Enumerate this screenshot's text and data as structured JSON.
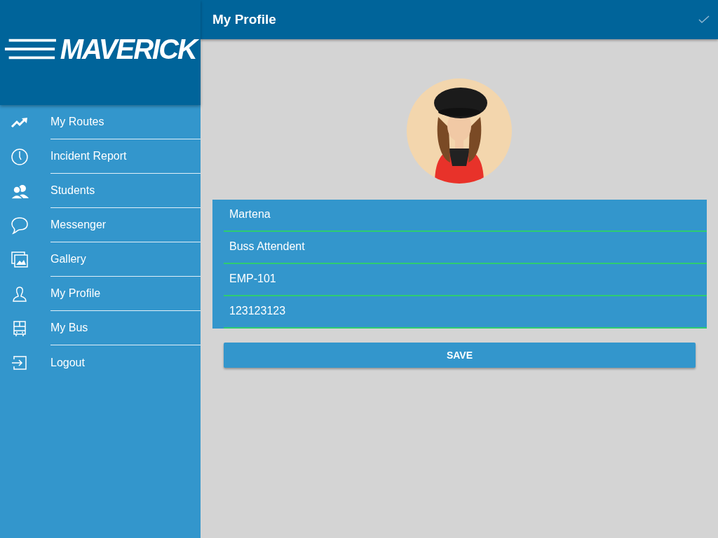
{
  "sidebar": {
    "logo": "MAVERICK",
    "items": [
      {
        "label": "My Routes",
        "selected": false
      },
      {
        "label": "Incident Report",
        "selected": false
      },
      {
        "label": "Students",
        "selected": false
      },
      {
        "label": "Messenger",
        "selected": false
      },
      {
        "label": "Gallery",
        "selected": false
      },
      {
        "label": "My Profile",
        "selected": false
      },
      {
        "label": "My Bus",
        "selected": false
      },
      {
        "label": "Logout",
        "selected": false
      }
    ]
  },
  "header": {
    "title": "My Profile"
  },
  "profile": {
    "fields": [
      {
        "value": "Martena"
      },
      {
        "value": "Buss Attendent"
      },
      {
        "value": "EMP-101"
      },
      {
        "value": "123123123"
      }
    ],
    "save_button": "SAVE"
  }
}
